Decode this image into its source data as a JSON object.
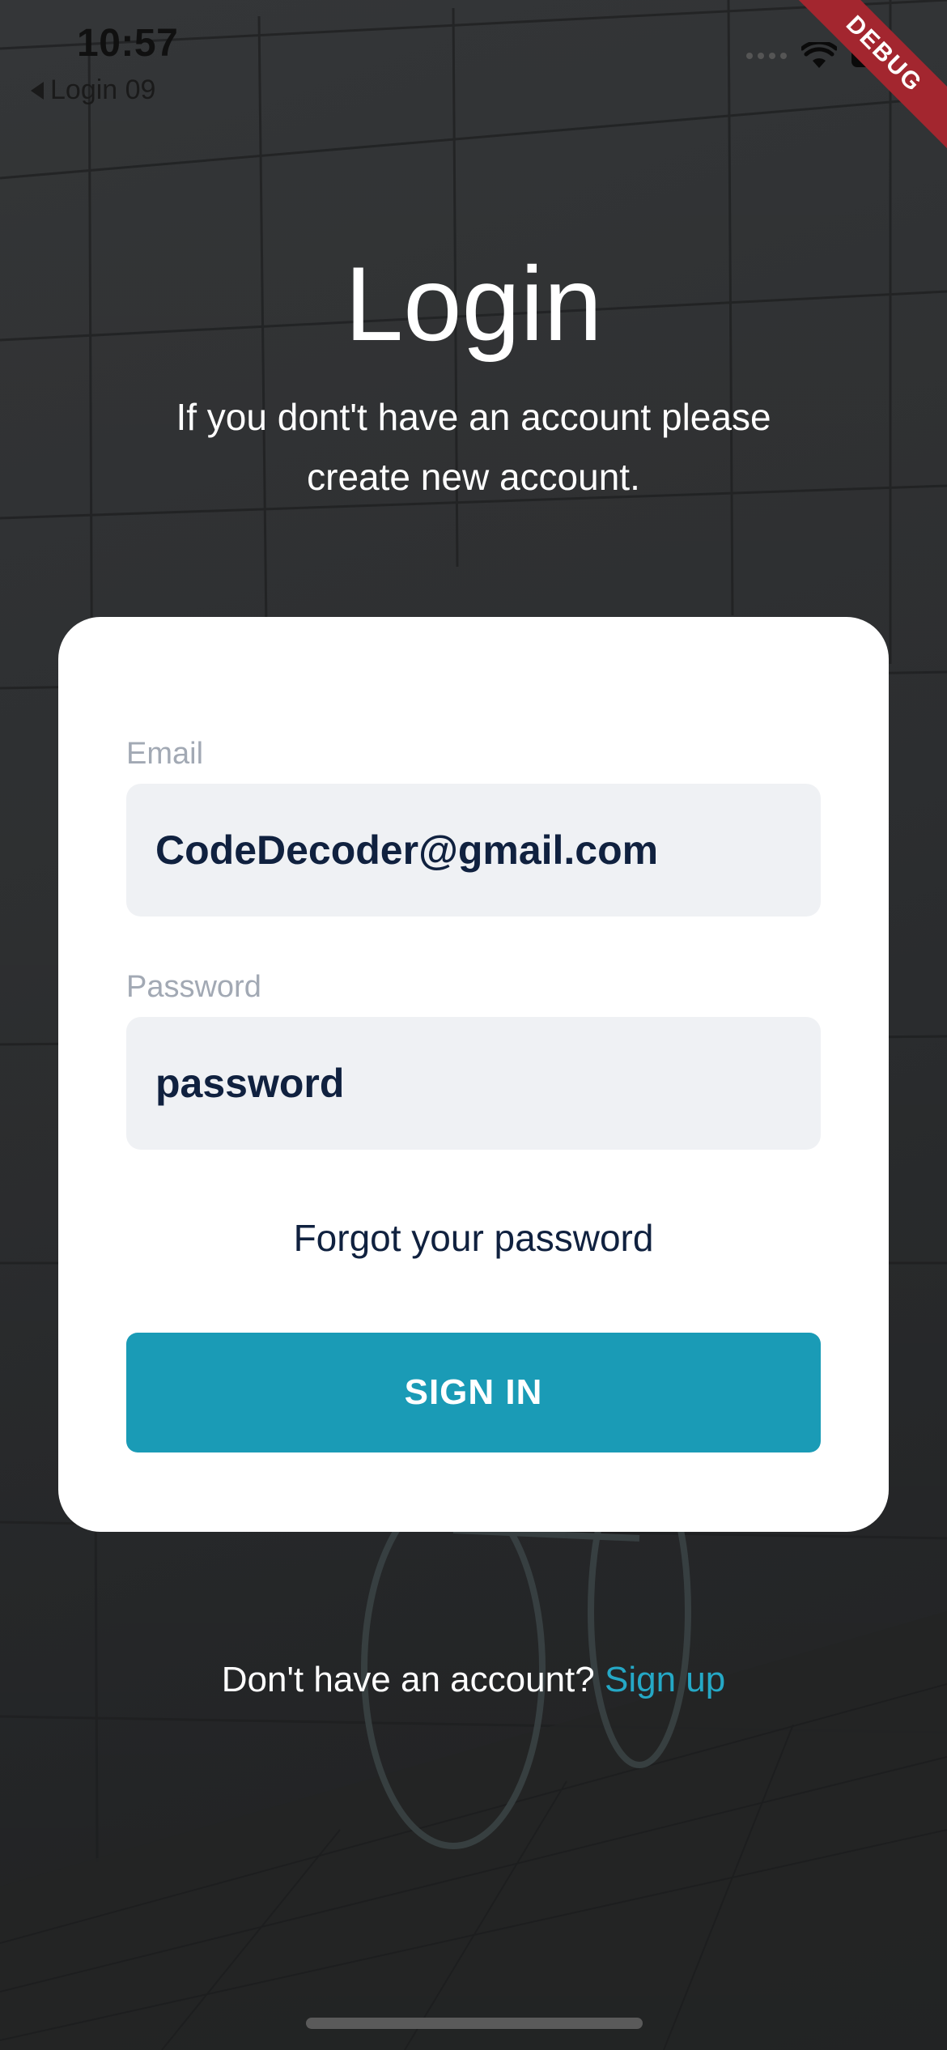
{
  "status_bar": {
    "time": "10:57",
    "back_app_label": "Login 09",
    "debug_label": "DEBUG"
  },
  "header": {
    "title": "Login",
    "subtitle": "If you dont't have an account please create new account."
  },
  "form": {
    "email_label": "Email",
    "email_value": "CodeDecoder@gmail.com",
    "password_label": "Password",
    "password_value": "password",
    "forgot_label": "Forgot your password",
    "signin_label": "SIGN IN"
  },
  "footer": {
    "prompt": "Don't have an account?",
    "signup_label": "Sign up"
  },
  "colors": {
    "accent": "#1a9bb6",
    "link": "#25a8c6",
    "text_dark": "#10213f",
    "label_gray": "#a2a9b4",
    "field_bg": "#eff1f4",
    "debug_ribbon": "#a3262f"
  }
}
